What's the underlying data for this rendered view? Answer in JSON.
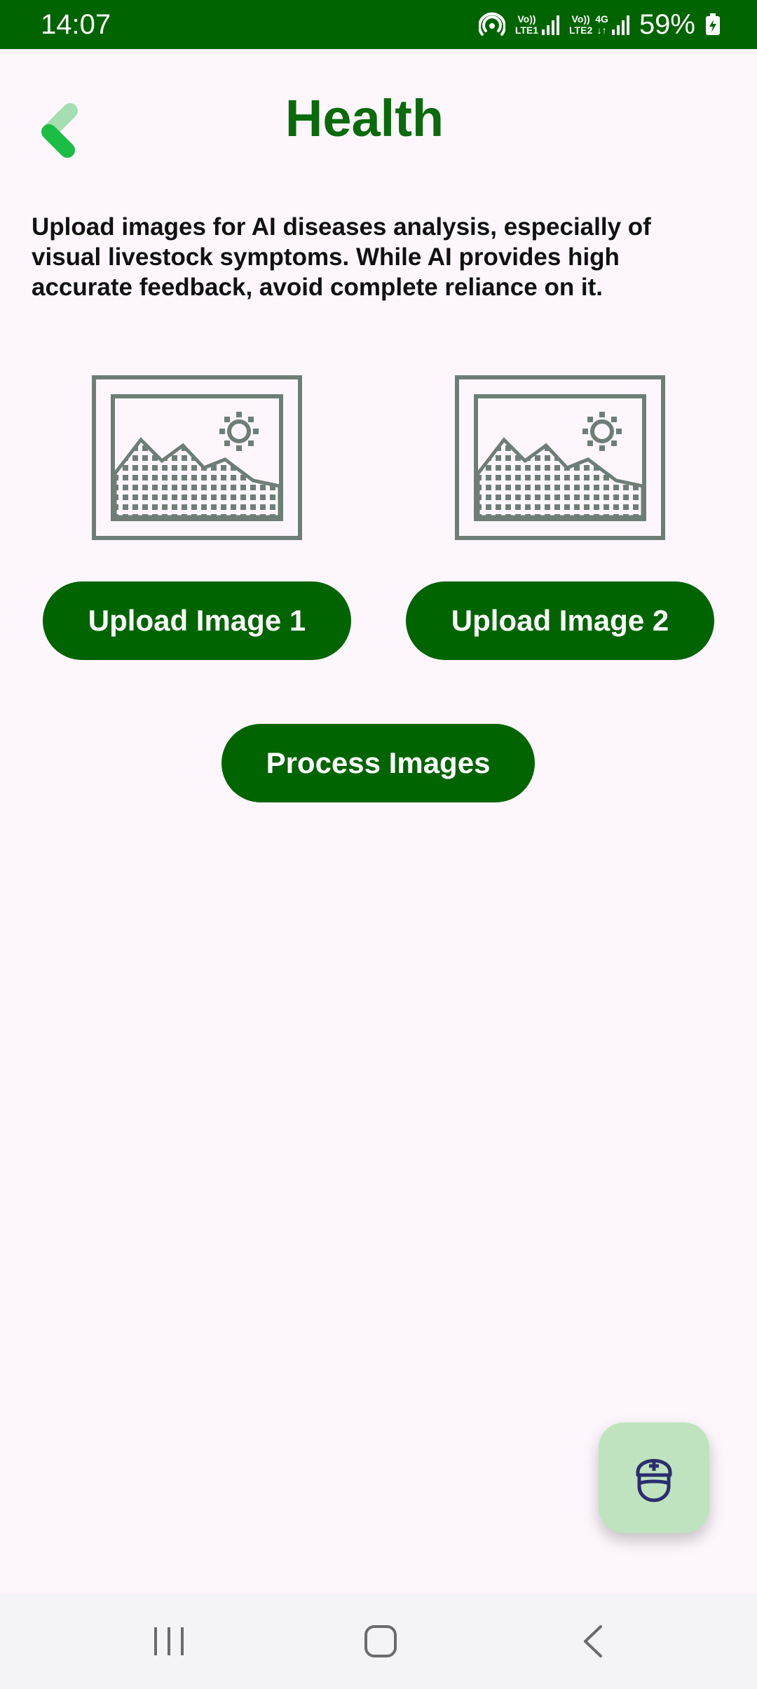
{
  "status_bar": {
    "time": "14:07",
    "sim1_label_top": "Vo))",
    "sim1_label_bottom": "LTE1",
    "sim2_label_top": "Vo))",
    "sim2_label_bottom": "LTE2",
    "network_type": "4G",
    "battery": "59%"
  },
  "header": {
    "title": "Health"
  },
  "main": {
    "description": "Upload images for AI diseases analysis, especially of visual livestock symptoms. While AI provides high accurate feedback, avoid complete reliance on it.",
    "upload_image_1_label": "Upload Image 1",
    "upload_image_2_label": "Upload Image 2",
    "process_images_label": "Process Images"
  },
  "colors": {
    "primary_green": "#006400",
    "title_green": "#0B6A0B",
    "fab_background": "#BFE3BE",
    "page_background": "#FDF7FD"
  },
  "icons": {
    "back": "back-chevron-icon",
    "placeholder": "image-placeholder-icon",
    "fab": "doctor-icon",
    "nav_recent": "recent-apps-icon",
    "nav_home": "home-icon",
    "nav_back": "back-icon"
  }
}
